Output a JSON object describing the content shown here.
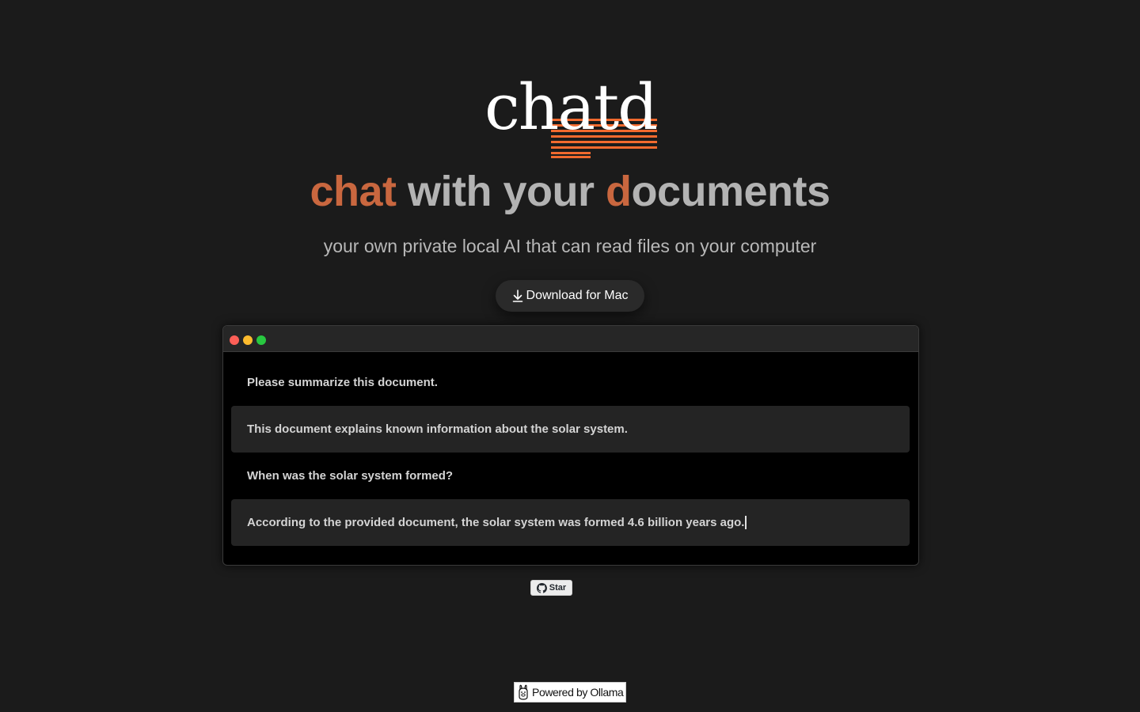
{
  "logo": {
    "text": "chatd"
  },
  "hero": {
    "headline_part1": "chat",
    "headline_part2": " with your ",
    "headline_part3": "d",
    "headline_part4": "ocuments",
    "subtitle": "your own private local AI that can read files on your computer",
    "download_label": "Download for Mac"
  },
  "demo_window": {
    "messages": [
      {
        "role": "user",
        "text": "Please summarize this document."
      },
      {
        "role": "assistant",
        "text": "This document explains known information about the solar system."
      },
      {
        "role": "user",
        "text": "When was the solar system formed?"
      },
      {
        "role": "assistant",
        "text": "According to the provided document, the solar system was formed 4.6 billion years ago."
      }
    ]
  },
  "github": {
    "star_label": "Star"
  },
  "footer": {
    "badge_label": "Powered by Ollama"
  },
  "colors": {
    "accent": "#c9673f",
    "logo_lines": "#f26a2e",
    "background": "#1b1b1b"
  }
}
